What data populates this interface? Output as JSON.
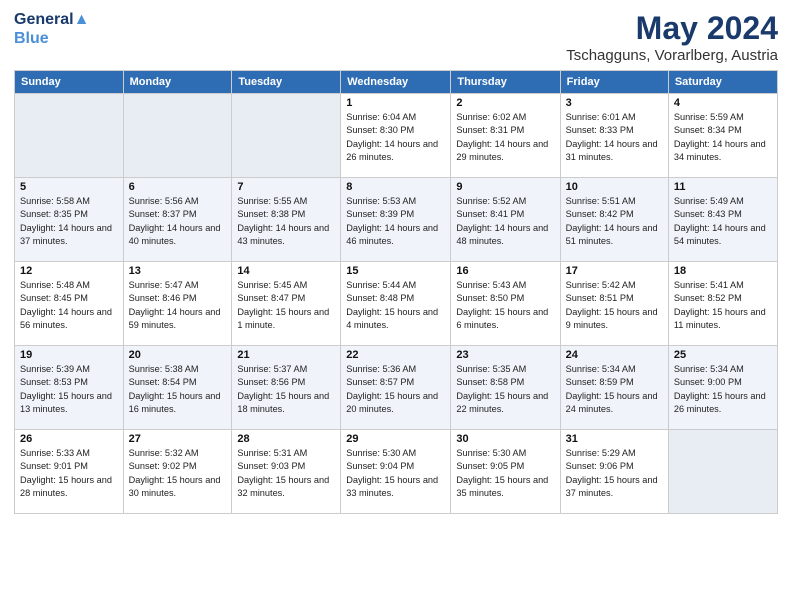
{
  "logo": {
    "line1": "General",
    "line2": "Blue"
  },
  "title": "May 2024",
  "subtitle": "Tschagguns, Vorarlberg, Austria",
  "weekdays": [
    "Sunday",
    "Monday",
    "Tuesday",
    "Wednesday",
    "Thursday",
    "Friday",
    "Saturday"
  ],
  "weeks": [
    [
      {
        "day": "",
        "info": ""
      },
      {
        "day": "",
        "info": ""
      },
      {
        "day": "",
        "info": ""
      },
      {
        "day": "1",
        "info": "Sunrise: 6:04 AM\nSunset: 8:30 PM\nDaylight: 14 hours\nand 26 minutes."
      },
      {
        "day": "2",
        "info": "Sunrise: 6:02 AM\nSunset: 8:31 PM\nDaylight: 14 hours\nand 29 minutes."
      },
      {
        "day": "3",
        "info": "Sunrise: 6:01 AM\nSunset: 8:33 PM\nDaylight: 14 hours\nand 31 minutes."
      },
      {
        "day": "4",
        "info": "Sunrise: 5:59 AM\nSunset: 8:34 PM\nDaylight: 14 hours\nand 34 minutes."
      }
    ],
    [
      {
        "day": "5",
        "info": "Sunrise: 5:58 AM\nSunset: 8:35 PM\nDaylight: 14 hours\nand 37 minutes."
      },
      {
        "day": "6",
        "info": "Sunrise: 5:56 AM\nSunset: 8:37 PM\nDaylight: 14 hours\nand 40 minutes."
      },
      {
        "day": "7",
        "info": "Sunrise: 5:55 AM\nSunset: 8:38 PM\nDaylight: 14 hours\nand 43 minutes."
      },
      {
        "day": "8",
        "info": "Sunrise: 5:53 AM\nSunset: 8:39 PM\nDaylight: 14 hours\nand 46 minutes."
      },
      {
        "day": "9",
        "info": "Sunrise: 5:52 AM\nSunset: 8:41 PM\nDaylight: 14 hours\nand 48 minutes."
      },
      {
        "day": "10",
        "info": "Sunrise: 5:51 AM\nSunset: 8:42 PM\nDaylight: 14 hours\nand 51 minutes."
      },
      {
        "day": "11",
        "info": "Sunrise: 5:49 AM\nSunset: 8:43 PM\nDaylight: 14 hours\nand 54 minutes."
      }
    ],
    [
      {
        "day": "12",
        "info": "Sunrise: 5:48 AM\nSunset: 8:45 PM\nDaylight: 14 hours\nand 56 minutes."
      },
      {
        "day": "13",
        "info": "Sunrise: 5:47 AM\nSunset: 8:46 PM\nDaylight: 14 hours\nand 59 minutes."
      },
      {
        "day": "14",
        "info": "Sunrise: 5:45 AM\nSunset: 8:47 PM\nDaylight: 15 hours\nand 1 minute."
      },
      {
        "day": "15",
        "info": "Sunrise: 5:44 AM\nSunset: 8:48 PM\nDaylight: 15 hours\nand 4 minutes."
      },
      {
        "day": "16",
        "info": "Sunrise: 5:43 AM\nSunset: 8:50 PM\nDaylight: 15 hours\nand 6 minutes."
      },
      {
        "day": "17",
        "info": "Sunrise: 5:42 AM\nSunset: 8:51 PM\nDaylight: 15 hours\nand 9 minutes."
      },
      {
        "day": "18",
        "info": "Sunrise: 5:41 AM\nSunset: 8:52 PM\nDaylight: 15 hours\nand 11 minutes."
      }
    ],
    [
      {
        "day": "19",
        "info": "Sunrise: 5:39 AM\nSunset: 8:53 PM\nDaylight: 15 hours\nand 13 minutes."
      },
      {
        "day": "20",
        "info": "Sunrise: 5:38 AM\nSunset: 8:54 PM\nDaylight: 15 hours\nand 16 minutes."
      },
      {
        "day": "21",
        "info": "Sunrise: 5:37 AM\nSunset: 8:56 PM\nDaylight: 15 hours\nand 18 minutes."
      },
      {
        "day": "22",
        "info": "Sunrise: 5:36 AM\nSunset: 8:57 PM\nDaylight: 15 hours\nand 20 minutes."
      },
      {
        "day": "23",
        "info": "Sunrise: 5:35 AM\nSunset: 8:58 PM\nDaylight: 15 hours\nand 22 minutes."
      },
      {
        "day": "24",
        "info": "Sunrise: 5:34 AM\nSunset: 8:59 PM\nDaylight: 15 hours\nand 24 minutes."
      },
      {
        "day": "25",
        "info": "Sunrise: 5:34 AM\nSunset: 9:00 PM\nDaylight: 15 hours\nand 26 minutes."
      }
    ],
    [
      {
        "day": "26",
        "info": "Sunrise: 5:33 AM\nSunset: 9:01 PM\nDaylight: 15 hours\nand 28 minutes."
      },
      {
        "day": "27",
        "info": "Sunrise: 5:32 AM\nSunset: 9:02 PM\nDaylight: 15 hours\nand 30 minutes."
      },
      {
        "day": "28",
        "info": "Sunrise: 5:31 AM\nSunset: 9:03 PM\nDaylight: 15 hours\nand 32 minutes."
      },
      {
        "day": "29",
        "info": "Sunrise: 5:30 AM\nSunset: 9:04 PM\nDaylight: 15 hours\nand 33 minutes."
      },
      {
        "day": "30",
        "info": "Sunrise: 5:30 AM\nSunset: 9:05 PM\nDaylight: 15 hours\nand 35 minutes."
      },
      {
        "day": "31",
        "info": "Sunrise: 5:29 AM\nSunset: 9:06 PM\nDaylight: 15 hours\nand 37 minutes."
      },
      {
        "day": "",
        "info": ""
      }
    ]
  ]
}
